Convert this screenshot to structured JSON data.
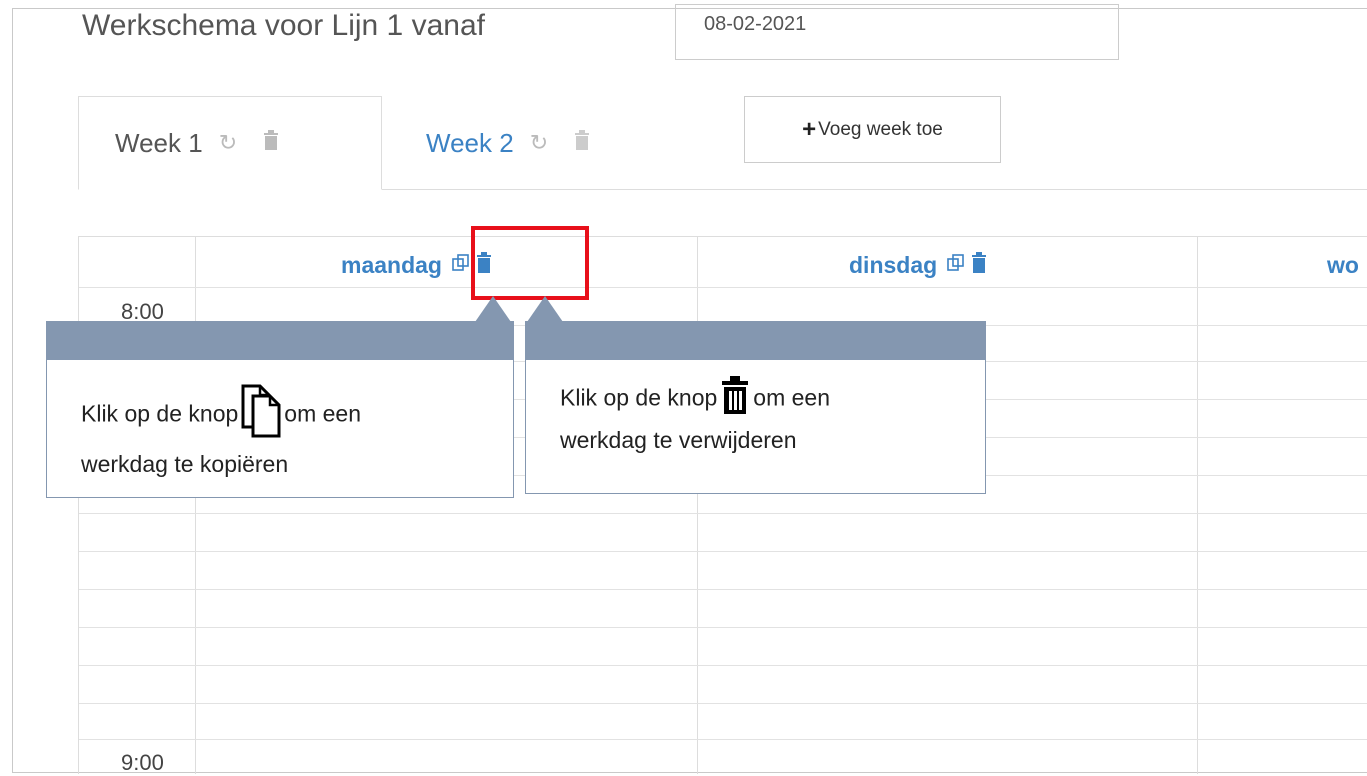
{
  "header": {
    "title": "Werkschema voor Lijn 1 vanaf",
    "start_date": "08-02-2021"
  },
  "tabs": [
    {
      "label": "Week 1",
      "active": true
    },
    {
      "label": "Week 2",
      "active": false
    }
  ],
  "add_week_label": "Voeg week toe",
  "days": [
    {
      "label": "maandag"
    },
    {
      "label": "dinsdag"
    },
    {
      "label": "wo"
    }
  ],
  "times": [
    "8:00",
    "9:00"
  ],
  "callouts": {
    "copy": {
      "line1_before": "Klik op de knop",
      "line1_after": "om een",
      "line2": "werkdag te kopiëren"
    },
    "delete": {
      "line1_before": "Klik op de knop",
      "line1_after": "om een",
      "line2": "werkdag te verwijderen"
    }
  },
  "icons": {
    "refresh": "refresh-icon",
    "trash": "trash-icon",
    "copy": "copy-icon",
    "plus": "plus-icon"
  },
  "colors": {
    "link_blue": "#3b82c4",
    "highlight_red": "#e8101a",
    "callout_slate": "#8497b0"
  }
}
